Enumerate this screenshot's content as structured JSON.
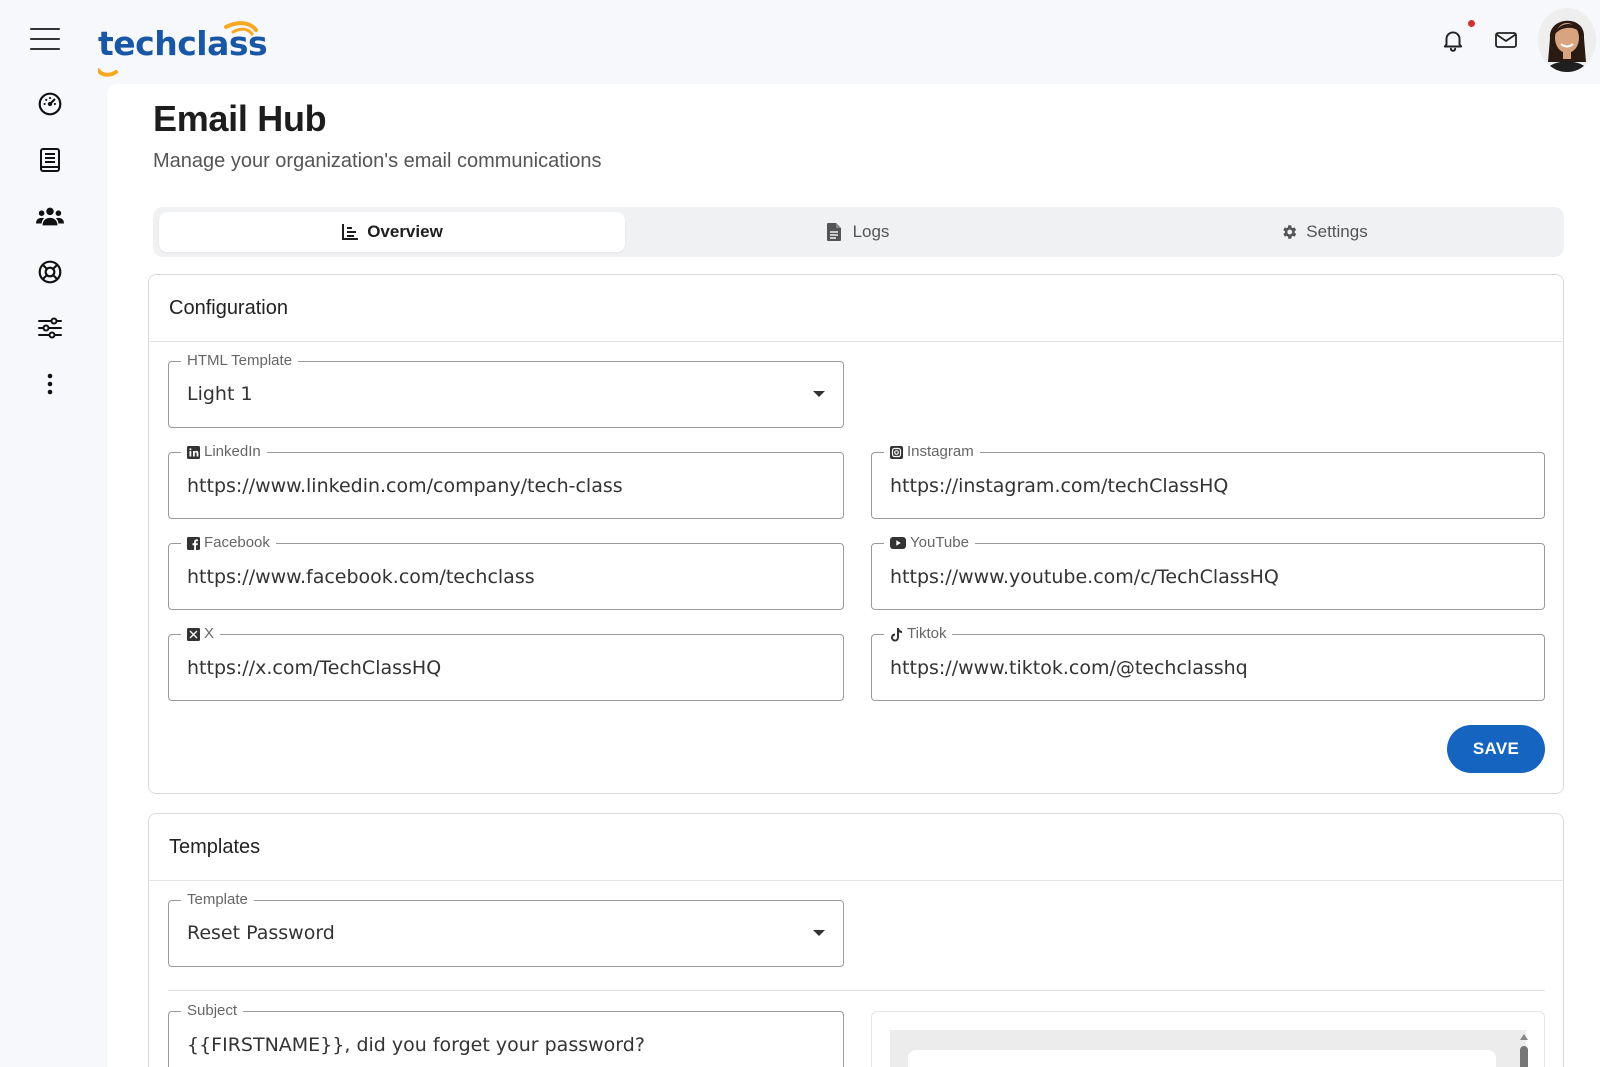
{
  "brand": {
    "logo_text": "techclass",
    "accent_color": "#1856a6",
    "arc_color": "#f7a823"
  },
  "topbar": {
    "menu_icon": "hamburger-menu-icon",
    "notifications_icon": "bell-icon",
    "notification_dot_color": "#d32f2f",
    "mail_icon": "mail-icon",
    "avatar": "user-avatar"
  },
  "sidebar": {
    "items": [
      {
        "icon": "dashboard-gauge-icon"
      },
      {
        "icon": "book-icon"
      },
      {
        "icon": "users-group-icon"
      },
      {
        "icon": "lifebuoy-icon"
      },
      {
        "icon": "sliders-icon"
      },
      {
        "icon": "more-vertical-icon"
      }
    ]
  },
  "page": {
    "title": "Email Hub",
    "subtitle": "Manage your organization's email communications"
  },
  "tabs": [
    {
      "label": "Overview",
      "icon": "chart-icon",
      "active": true
    },
    {
      "label": "Logs",
      "icon": "file-icon",
      "active": false
    },
    {
      "label": "Settings",
      "icon": "gear-icon",
      "active": false
    }
  ],
  "configuration": {
    "title": "Configuration",
    "html_template": {
      "label": "HTML Template",
      "value": "Light 1"
    },
    "linkedin": {
      "label": "LinkedIn",
      "value": "https://www.linkedin.com/company/tech-class"
    },
    "instagram": {
      "label": "Instagram",
      "value": "https://instagram.com/techClassHQ"
    },
    "facebook": {
      "label": "Facebook",
      "value": "https://www.facebook.com/techclass"
    },
    "youtube": {
      "label": "YouTube",
      "value": "https://www.youtube.com/c/TechClassHQ"
    },
    "x": {
      "label": "X",
      "value": "https://x.com/TechClassHQ"
    },
    "tiktok": {
      "label": "Tiktok",
      "value": "https://www.tiktok.com/@techclasshq"
    },
    "save_label": "SAVE",
    "save_color": "#1565c0"
  },
  "templates": {
    "title": "Templates",
    "template": {
      "label": "Template",
      "value": "Reset Password"
    },
    "subject": {
      "label": "Subject",
      "value": "{{FIRSTNAME}}, did you forget your password?"
    }
  }
}
